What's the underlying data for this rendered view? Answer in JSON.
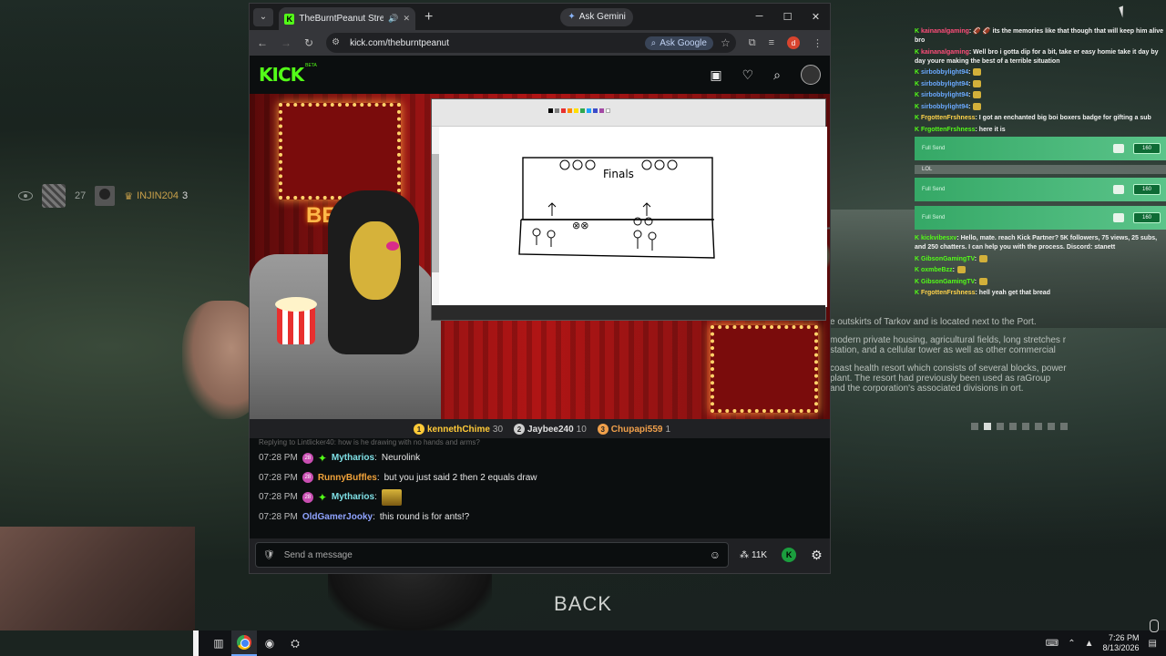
{
  "browser": {
    "tab_title": "TheBurntPeanut Stream - W",
    "gemini_label": "Ask Gemini",
    "url": "kick.com/theburntpeanut",
    "ask_google_label": "Ask Google",
    "profile_initial": "d"
  },
  "kick": {
    "logo": "KICK",
    "beta": "BETA"
  },
  "stream": {
    "neon_text": "BE",
    "drawing_text": "Finals"
  },
  "top_chatters": [
    {
      "rank": "1",
      "name": "kennethChime",
      "count": "30"
    },
    {
      "rank": "2",
      "name": "Jaybee240",
      "count": "10"
    },
    {
      "rank": "3",
      "name": "Chupapi559",
      "count": "1"
    }
  ],
  "chat": {
    "reply_line": "Replying to Lintlicker40: how is he drawing with no hands and arms?",
    "messages": [
      {
        "time": "07:28 PM",
        "badge": "28",
        "user": "Mytharios",
        "user_color": "#7fe0e6",
        "text": "Neurolink"
      },
      {
        "time": "07:28 PM",
        "badge": "28",
        "user": "RunnyBuffles",
        "user_color": "#f0a23a",
        "text": "but you just said 2 then 2 equals draw"
      },
      {
        "time": "07:28 PM",
        "badge": "28",
        "user": "Mytharios",
        "user_color": "#7fe0e6",
        "text": ""
      },
      {
        "time": "07:28 PM",
        "badge": "",
        "user": "OldGamerJooky",
        "user_color": "#8fa3ff",
        "text": "this round is for ants!?"
      }
    ],
    "input_placeholder": "Send a message",
    "viewers": "11K"
  },
  "hud": {
    "count": "27",
    "player": "INJIN204",
    "player_level": "3"
  },
  "game": {
    "desc_1": "e outskirts of Tarkov and is located next to the Port.",
    "desc_2": "modern private housing, agricultural fields, long stretches r station, and a cellular tower as well as other commercial",
    "desc_3": "coast health resort which consists of several blocks, power plant. The resort had previously been used as raGroup and the corporation's associated divisions in ort.",
    "back_label": "BACK"
  },
  "overlay_chat": [
    {
      "name": "kainanalgaming",
      "color": "red",
      "text": ": 🏈 🏈 its the memories like that though that will keep him alive bro"
    },
    {
      "name": "kainanalgaming",
      "color": "red",
      "text": ": Well bro i gotta dip for a bit, take er easy homie take it day by day youre making the best of a terrible situation"
    },
    {
      "name": "sirbobbylight94",
      "color": "blue",
      "text": ":"
    },
    {
      "name": "sirbobbylight94",
      "color": "blue",
      "text": ":"
    },
    {
      "name": "sirbobbylight94",
      "color": "blue",
      "text": ":"
    },
    {
      "name": "sirbobbylight94",
      "color": "blue",
      "text": ":"
    },
    {
      "name": "FrgottenFrshness",
      "color": "yellow",
      "text": ": I got an enchanted big boi boxers badge for gifting a sub"
    },
    {
      "name": "FrgottenFrshness",
      "color": "green",
      "text": ": here it is"
    }
  ],
  "overlay_gifts": [
    {
      "text": "Full Send",
      "pill": "160"
    },
    {
      "text": "LOL",
      "pill": ""
    },
    {
      "text": "Full Send",
      "pill": "160"
    },
    {
      "text": "Full Send",
      "pill": "160"
    }
  ],
  "overlay_chat_2": [
    {
      "name": "kickvibesxv",
      "color": "green",
      "text": ": Hello, mate. reach Kick Partner? 5K followers, 75 views, 25 subs, and 250 chatters. I can help you with the process. Discord: stanett"
    },
    {
      "name": "GibsonGamingTV",
      "color": "green",
      "text": ":"
    },
    {
      "name": "oxmbeBzz",
      "color": "green",
      "text": ":"
    },
    {
      "name": "GibsonGamingTV",
      "color": "green",
      "text": ":"
    },
    {
      "name": "FrgottenFrshness",
      "color": "yellow",
      "text": ": hell yeah get that bread"
    }
  ],
  "taskbar": {
    "time": "7:26 PM",
    "date": "8/13/2026"
  }
}
